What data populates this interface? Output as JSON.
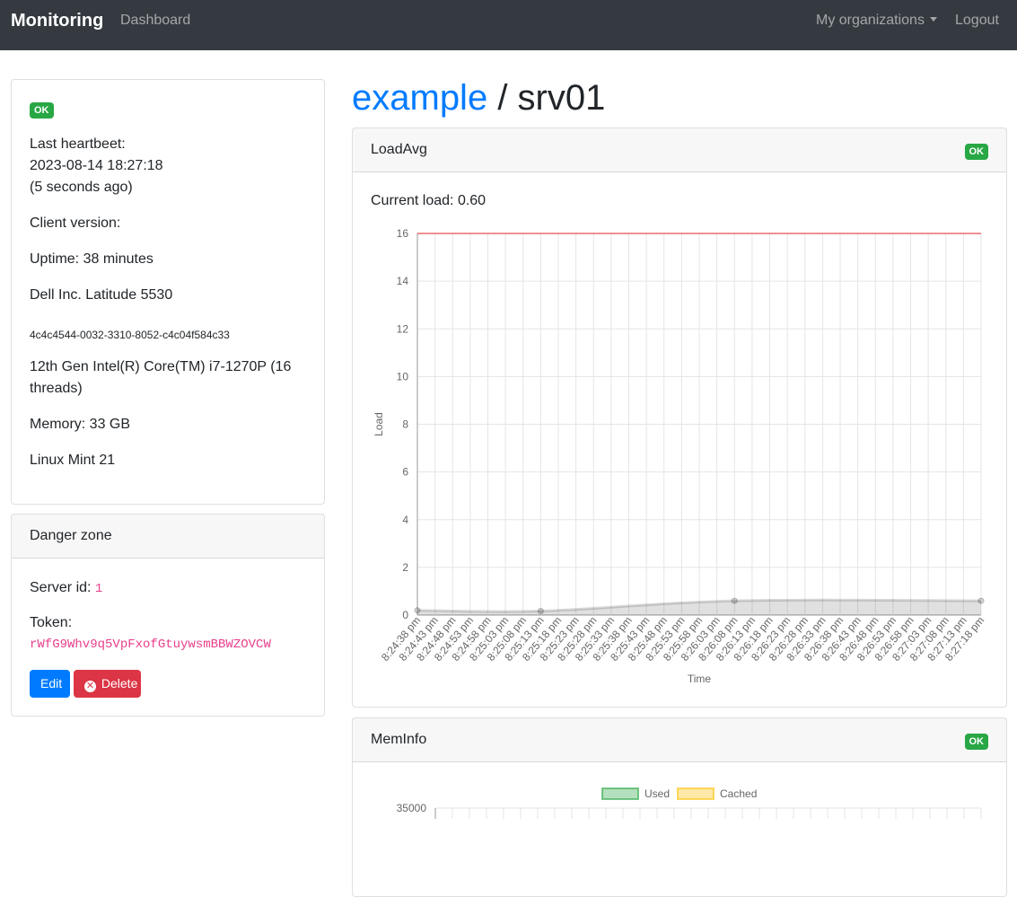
{
  "navbar": {
    "brand": "Monitoring",
    "dashboard": "Dashboard",
    "organizations": "My organizations",
    "logout": "Logout"
  },
  "title": {
    "org": "example",
    "separator": " / ",
    "server": "srv01"
  },
  "info": {
    "status": "OK",
    "heartbeat_label": "Last heartbeet:",
    "heartbeat_time": "2023-08-14 18:27:18",
    "heartbeat_ago": "(5 seconds ago)",
    "client_version": "Client version:",
    "uptime": "Uptime: 38 minutes",
    "hardware": "Dell Inc. Latitude 5530",
    "uuid": "4c4c4544-0032-3310-8052-c4c04f584c33",
    "cpu_line1": "12th Gen Intel(R) Core(TM) i7-1270P (16",
    "cpu_line2": "threads)",
    "memory": "Memory: 33 GB",
    "os": "Linux Mint 21"
  },
  "danger": {
    "header": "Danger zone",
    "server_id_label": "Server id: ",
    "server_id": "1",
    "token_label": "Token:",
    "token": "rWfG9Whv9q5VpFxofGtuywsmBBWZOVCW",
    "edit": "Edit",
    "delete": "Delete"
  },
  "loadavg": {
    "header": "LoadAvg",
    "status": "OK",
    "current": "Current load: 0.60"
  },
  "meminfo": {
    "header": "MemInfo",
    "status": "OK"
  },
  "colors": {
    "primary": "#007bff",
    "success": "#28a745",
    "danger": "#dc3545",
    "navbar": "#343a40",
    "threshold_line": "#e02020"
  },
  "chart_data": [
    {
      "type": "area",
      "title": "",
      "xlabel": "Time",
      "ylabel": "Load",
      "ylim": [
        0,
        16
      ],
      "yticks": [
        0,
        2,
        4,
        6,
        8,
        10,
        12,
        14,
        16
      ],
      "grid": true,
      "x": [
        "8:24:38 pm",
        "8:24:43 pm",
        "8:24:48 pm",
        "8:24:53 pm",
        "8:24:58 pm",
        "8:25:03 pm",
        "8:25:08 pm",
        "8:25:13 pm",
        "8:25:18 pm",
        "8:25:23 pm",
        "8:25:28 pm",
        "8:25:33 pm",
        "8:25:38 pm",
        "8:25:43 pm",
        "8:25:48 pm",
        "8:25:53 pm",
        "8:25:58 pm",
        "8:26:03 pm",
        "8:26:08 pm",
        "8:26:13 pm",
        "8:26:18 pm",
        "8:26:23 pm",
        "8:26:28 pm",
        "8:26:33 pm",
        "8:26:38 pm",
        "8:26:43 pm",
        "8:26:48 pm",
        "8:26:53 pm",
        "8:26:58 pm",
        "8:27:03 pm",
        "8:27:08 pm",
        "8:27:13 pm",
        "8:27:18 pm"
      ],
      "series": [
        {
          "points": [
            {
              "x": "8:24:38 pm",
              "y": 0.2
            },
            {
              "x": "8:25:13 pm",
              "y": 0.17
            },
            {
              "x": "8:26:08 pm",
              "y": 0.6
            },
            {
              "x": "8:27:18 pm",
              "y": 0.6
            }
          ]
        },
        {
          "points": [
            {
              "x": "8:24:38 pm",
              "y": 16
            },
            {
              "x": "8:27:18 pm",
              "y": 16
            }
          ]
        }
      ]
    },
    {
      "type": "area",
      "title": "",
      "ylim": [
        0,
        35000
      ],
      "yticks": [
        35000
      ],
      "legend": "top",
      "series": [
        {
          "name": "Used",
          "color": "#28a745",
          "values": []
        },
        {
          "name": "Cached",
          "color": "#ffc107",
          "values": []
        }
      ]
    }
  ]
}
